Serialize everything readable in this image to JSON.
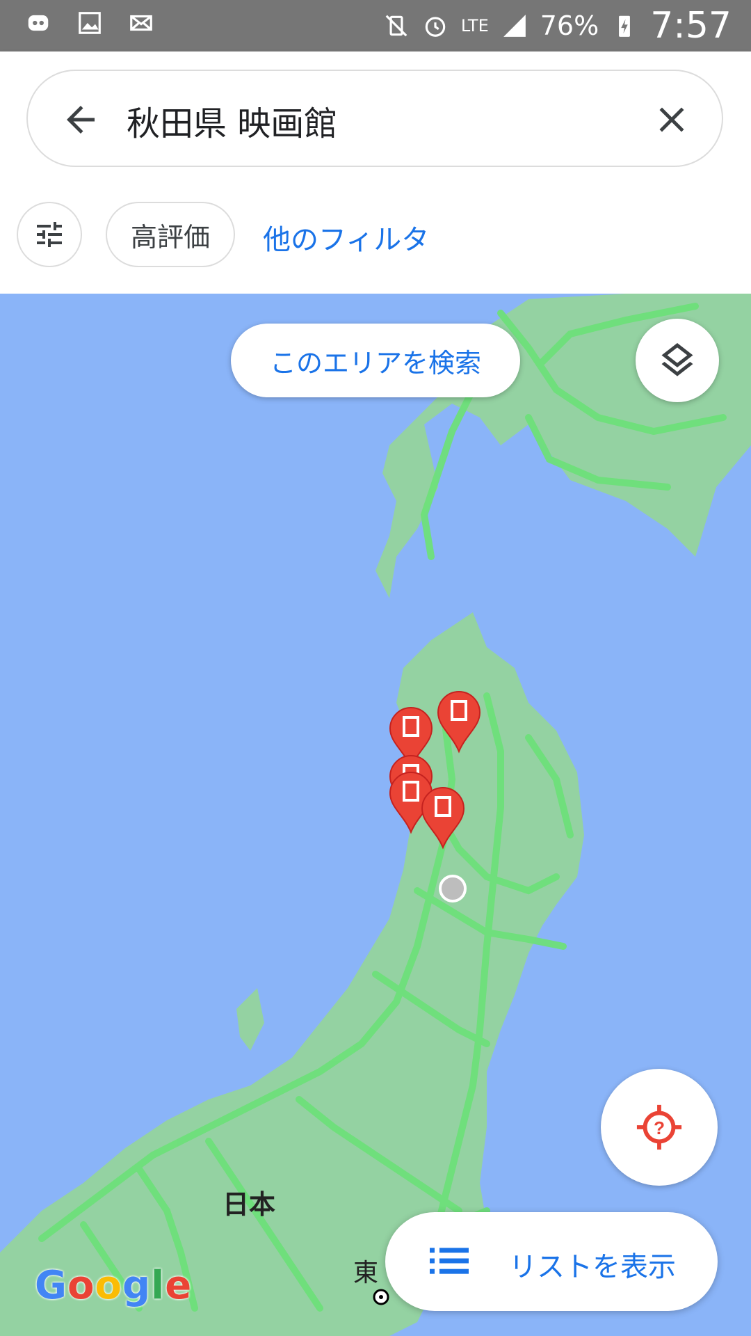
{
  "status_bar": {
    "battery": "76%",
    "network": "LTE",
    "time": "7:57"
  },
  "search": {
    "query": "秋田県 映画館"
  },
  "filters": {
    "top_rated": "高評価",
    "more_filters": "他のフィルタ"
  },
  "map": {
    "search_this_area": "このエリアを検索",
    "labels": {
      "japan": "日本",
      "tokyo": "東"
    },
    "brand": "Google",
    "results_count": 5
  },
  "bottom": {
    "show_list": "リストを表示"
  },
  "colors": {
    "accent": "#1a73e8",
    "water": "#8ab4f8",
    "land": "#94d2a2",
    "roads": "#6ee07a",
    "pin": "#ea4335"
  },
  "icons": [
    "back-arrow-icon",
    "close-icon",
    "tune-icon",
    "layers-icon",
    "locate-icon",
    "list-icon",
    "movie-pin-icon"
  ]
}
